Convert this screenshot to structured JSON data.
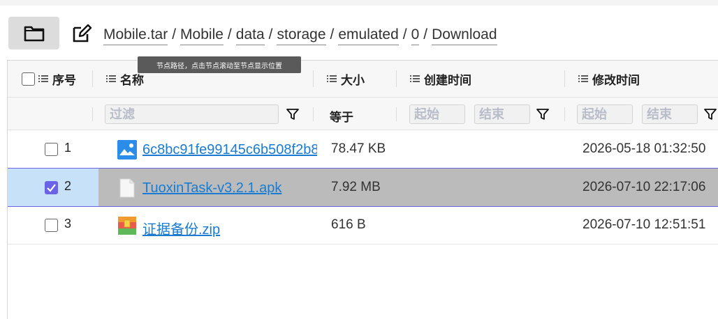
{
  "breadcrumb": [
    "Mobile.tar",
    "Mobile",
    "data",
    "storage",
    "emulated",
    "0",
    "Download"
  ],
  "breadcrumb_separator": "/",
  "tooltip": "节点路径，点击节点滚动至节点显示位置",
  "columns": {
    "index": "序号",
    "name": "名称",
    "size": "大小",
    "created": "创建时间",
    "modified": "修改时间"
  },
  "filters": {
    "name_placeholder": "过滤",
    "size_op": "等于",
    "created_start": "起始",
    "created_end": "结束",
    "modified_start": "起始",
    "modified_end": "结束"
  },
  "rows": [
    {
      "index": "1",
      "name": "6c8bc91fe99145c6b508f2b8",
      "size": "78.47 KB",
      "created": "",
      "modified": "2026-05-18 01:32:50",
      "type": "image-icon",
      "checked": false
    },
    {
      "index": "2",
      "name": "TuoxinTask-v3.2.1.apk",
      "size": "7.92 MB",
      "created": "",
      "modified": "2026-07-10 22:17:06",
      "type": "file-icon",
      "checked": true
    },
    {
      "index": "3",
      "name": "证据备份.zip",
      "size": "616 B",
      "created": "",
      "modified": "2026-07-10 12:51:51",
      "type": "archive-icon",
      "checked": false
    }
  ],
  "colors": {
    "link": "#1a7bd1",
    "accent": "#6a63e6",
    "selected_row": "#bbbbbb",
    "selected_check_cell": "#c6e1f8"
  }
}
